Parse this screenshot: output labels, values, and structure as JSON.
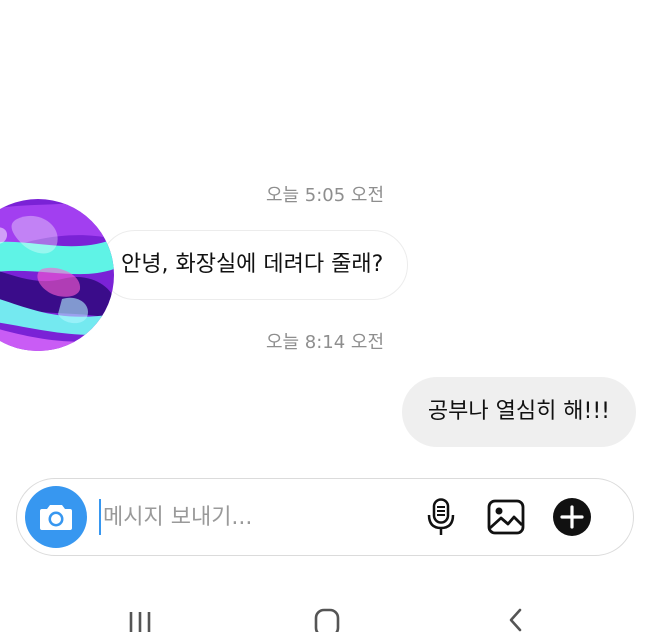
{
  "conversation": {
    "messages": [
      {
        "timestamp": "오늘 5:05 오전",
        "direction": "incoming",
        "text": "안녕, 화장실에 데려다 줄래?"
      },
      {
        "timestamp": "오늘 8:14 오전",
        "direction": "outgoing",
        "text": "공부나 열심히 해!!!"
      }
    ]
  },
  "composer": {
    "placeholder": "메시지 보내기...",
    "value": "",
    "icons": {
      "camera": "camera-icon",
      "microphone": "microphone-icon",
      "gallery": "gallery-icon",
      "add": "plus-icon"
    }
  },
  "navbar": {
    "icons": [
      "recent-apps-icon",
      "home-icon",
      "back-icon"
    ]
  },
  "colors": {
    "accent": "#3797f0",
    "outgoing_bubble": "#efefef",
    "timestamp": "#8e8e8e",
    "avatar_purple": "#8a2be2",
    "avatar_cyan": "#5ff3e6"
  }
}
